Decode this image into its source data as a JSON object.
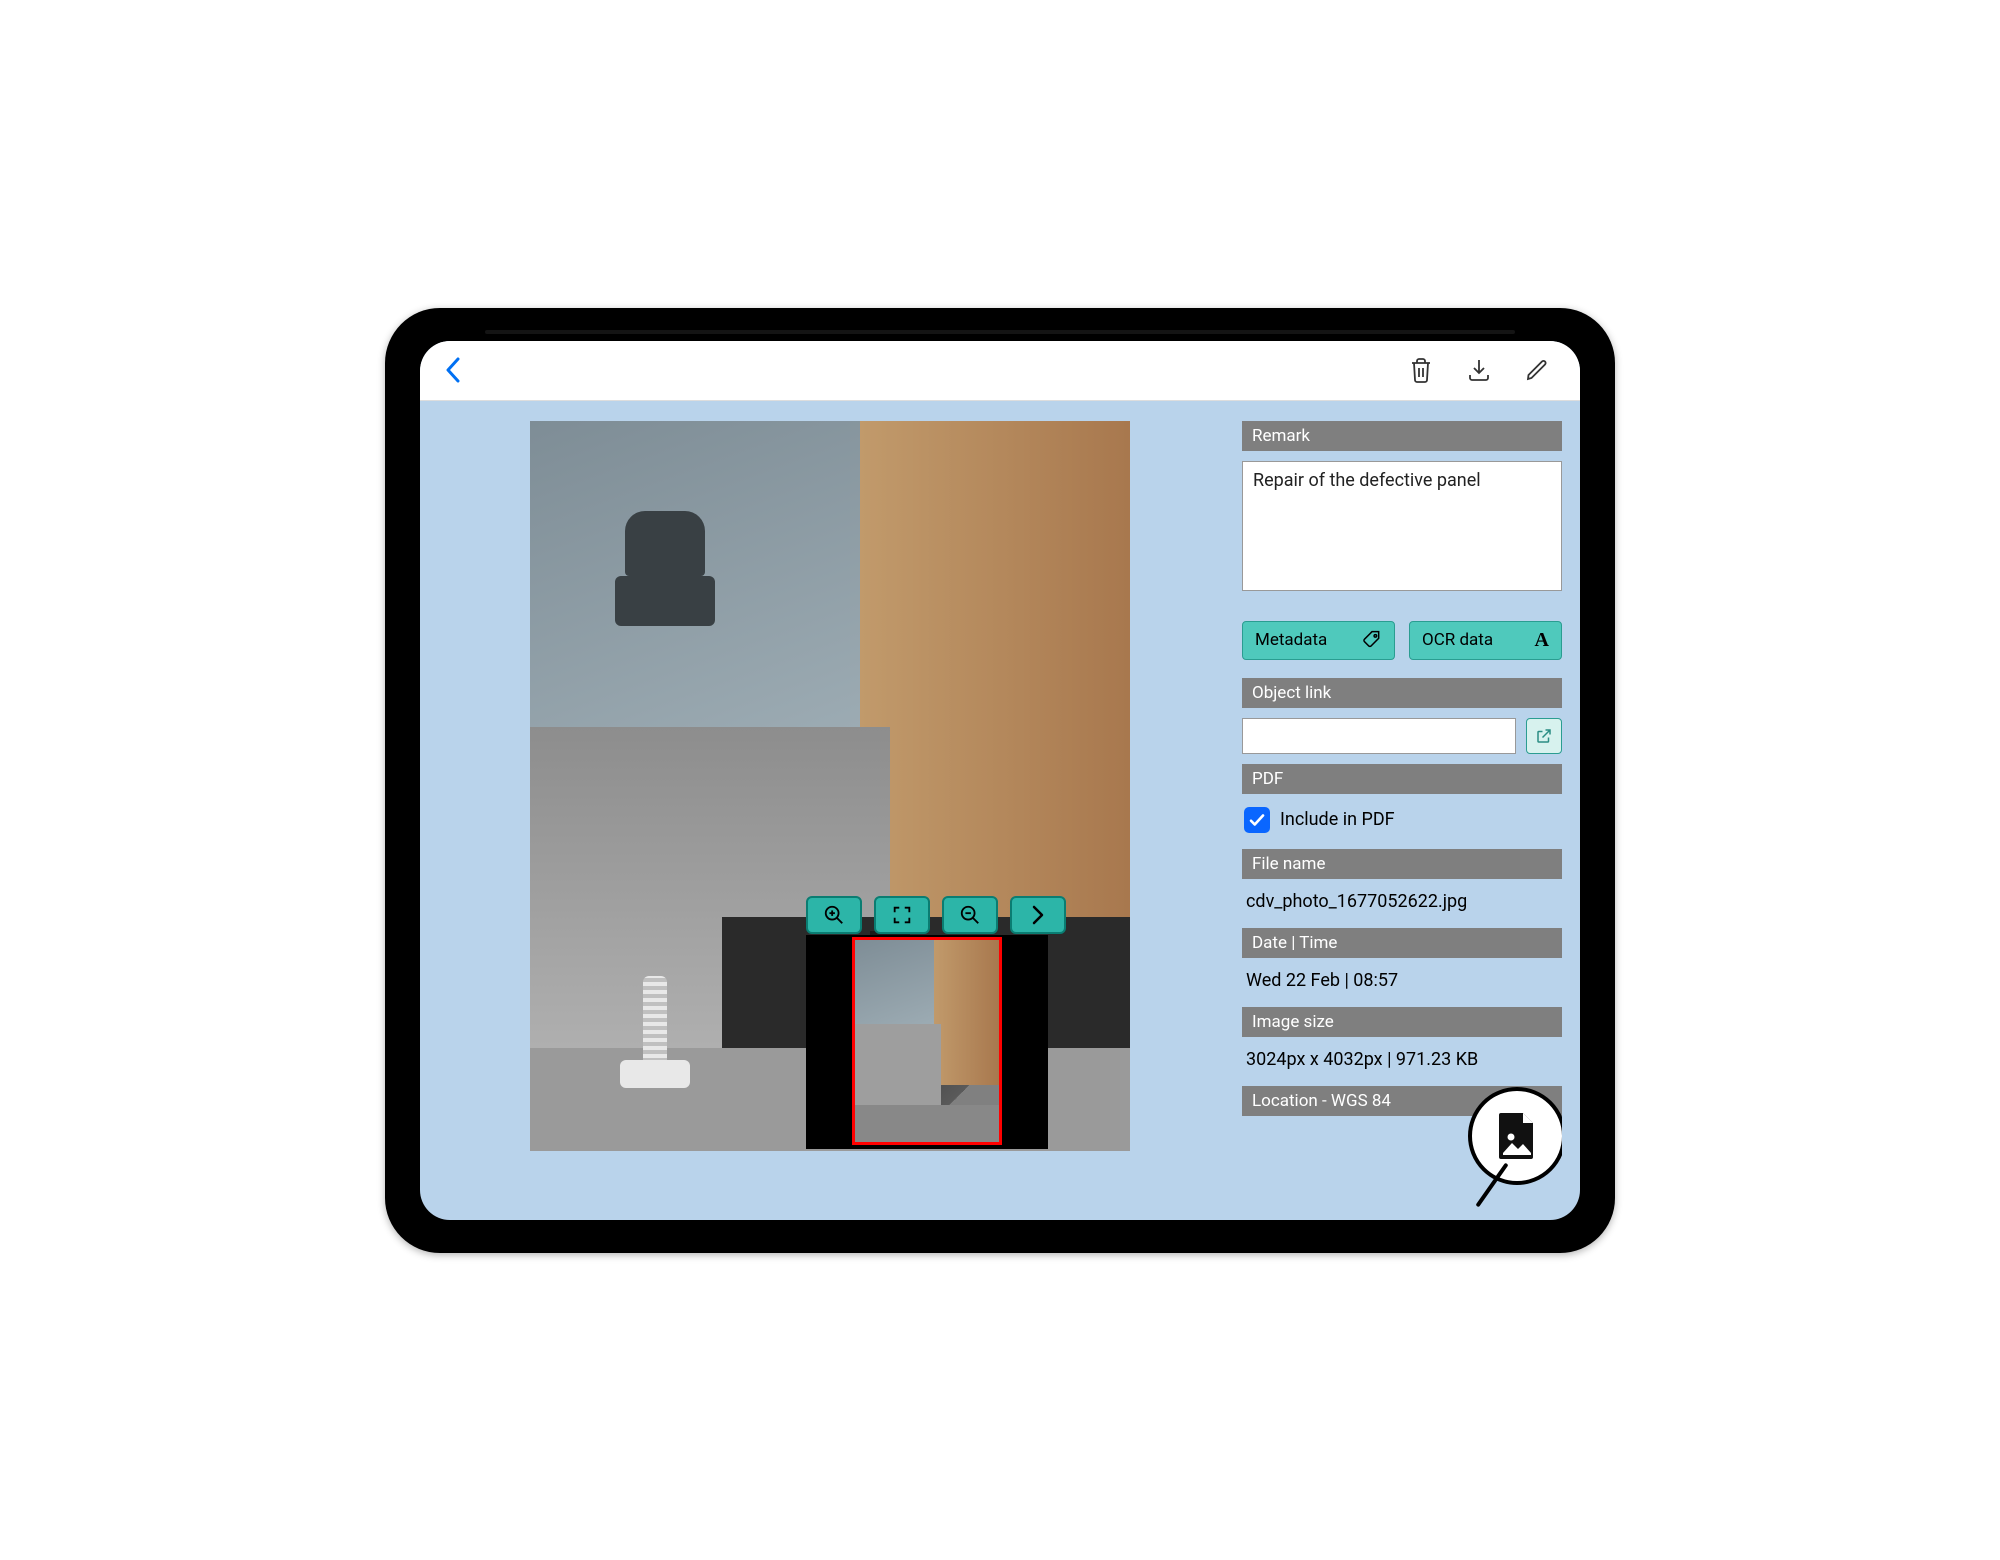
{
  "sidebar": {
    "remark_header": "Remark",
    "remark_text": "Repair of the defective panel",
    "metadata_btn": "Metadata",
    "ocr_btn": "OCR data",
    "object_link_header": "Object link",
    "object_link_value": "",
    "pdf_header": "PDF",
    "include_pdf_label": "Include in PDF",
    "filename_header": "File name",
    "filename_value": "cdv_photo_1677052622.jpg",
    "datetime_header": "Date | Time",
    "datetime_value": "Wed 22 Feb | 08:57",
    "imagesize_header": "Image size",
    "imagesize_value": "3024px x 4032px | 971.23 KB",
    "location_header": "Location - WGS 84"
  }
}
